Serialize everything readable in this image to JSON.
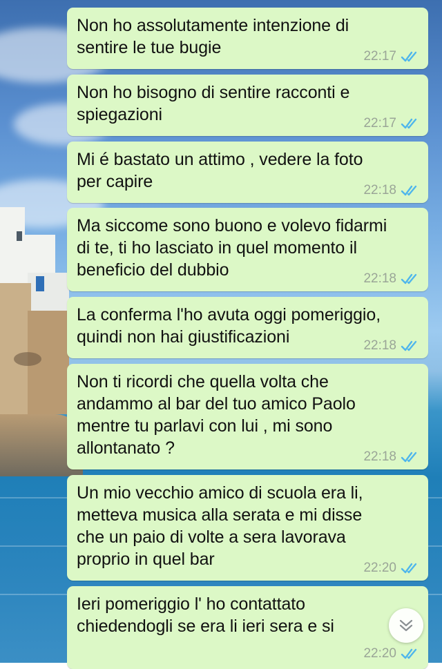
{
  "messages": [
    {
      "text": "Non ho assolutamente intenzione di\nsentire le tue bugie",
      "time": "22:17",
      "status": "read"
    },
    {
      "text": "Non ho bisogno di sentire racconti e\nspiegazioni",
      "time": "22:17",
      "status": "read"
    },
    {
      "text": "Mi é bastato un attimo , vedere la foto\nper capire",
      "time": "22:18",
      "status": "read"
    },
    {
      "text": "Ma siccome sono buono e volevo fidarmi\ndi te, ti ho lasciato in quel momento il\nbeneficio del dubbio",
      "time": "22:18",
      "status": "read"
    },
    {
      "text": "La conferma l'ho avuta oggi pomeriggio,\nquindi non hai giustificazioni",
      "time": "22:18",
      "status": "read"
    },
    {
      "text": "Non ti ricordi che quella volta che\nandammo al bar del tuo amico Paolo\nmentre tu parlavi con lui , mi sono\nallontanato ?",
      "time": "22:18",
      "status": "read"
    },
    {
      "text": "Un mio vecchio amico di scuola era li,\nmetteva musica alla serata e mi disse\nche un paio di volte a sera lavorava\nproprio in quel bar",
      "time": "22:20",
      "status": "read"
    },
    {
      "text": "Ieri pomeriggio l' ho contattato\nchiedendogli se era li ieri sera e si",
      "time": "22:20",
      "status": "read"
    }
  ],
  "icons": {
    "read_receipt": "double-check-icon",
    "scroll_down": "chevron-down-double-icon"
  },
  "colors": {
    "bubble_outgoing": "#dcf8c6",
    "read_tick": "#4fb6ec",
    "timestamp": "#9aa597"
  }
}
